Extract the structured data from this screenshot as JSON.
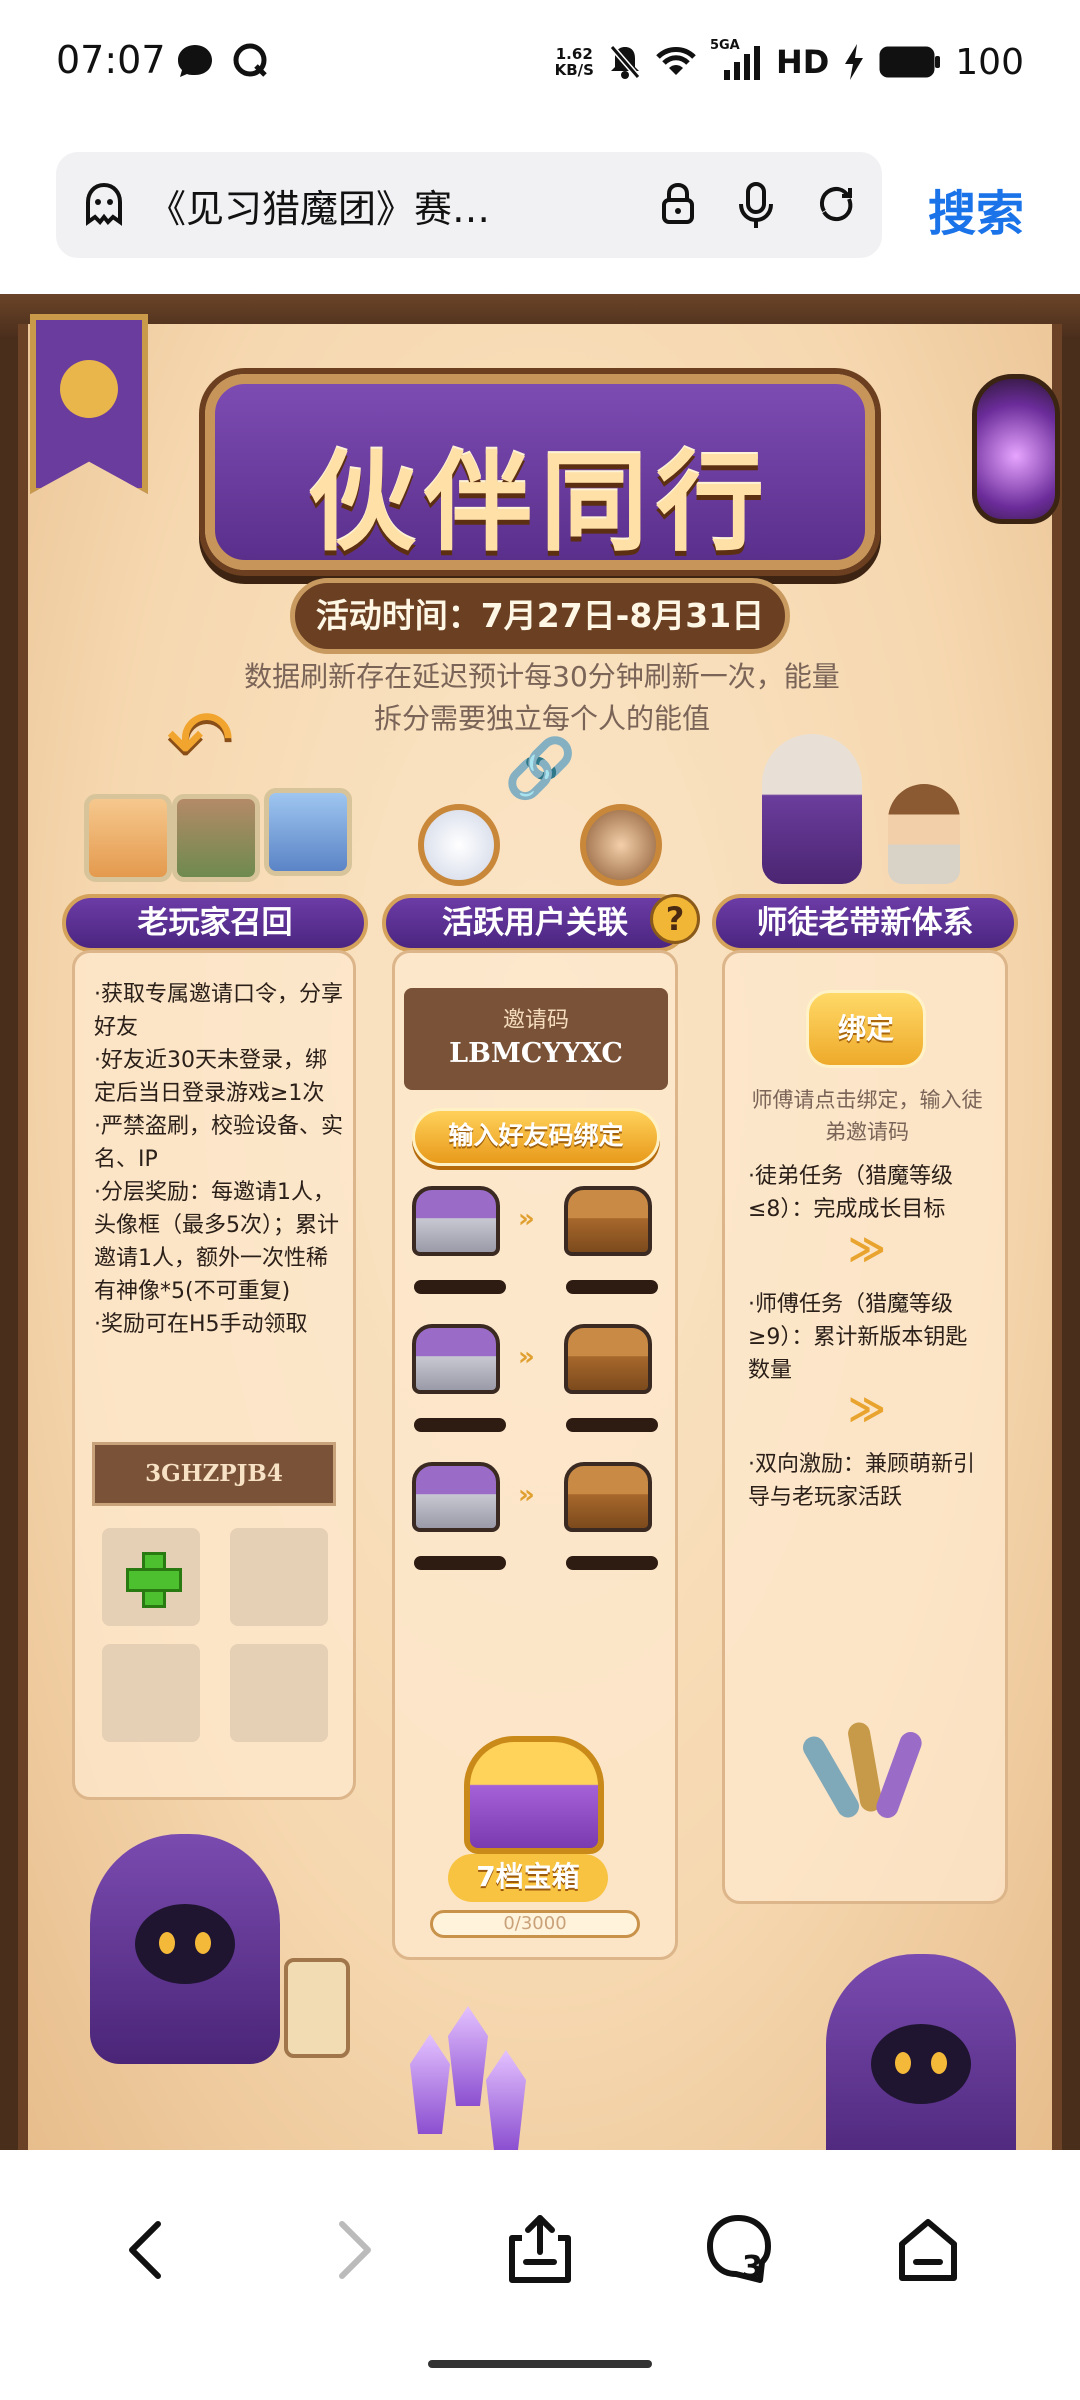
{
  "status_bar": {
    "time": "07:07",
    "net_speed_value": "1.62",
    "net_speed_unit": "KB/S",
    "network_label": "5GA",
    "hd_label": "HD",
    "battery": "100",
    "icons": [
      "chat-bubble-icon",
      "q-logo-icon",
      "mute-icon",
      "wifi-icon",
      "signal-icon",
      "charging-icon",
      "battery-icon"
    ]
  },
  "address_bar": {
    "title": "《见习猎魔团》赛…",
    "search_label": "搜索",
    "icons": [
      "ghost-icon",
      "lock-icon",
      "mic-icon",
      "refresh-icon"
    ]
  },
  "game": {
    "title": "伙伴同行",
    "event_time": "活动时间：7月27日-8月31日",
    "notice": "数据刷新存在延迟预计每30分钟刷新一次，能量拆分需要独立每个人的能值",
    "sections": {
      "left_title": "老玩家召回",
      "middle_title": "活跃用户关联",
      "middle_help": "?",
      "right_title": "师徒老带新体系"
    },
    "left": {
      "rules": [
        "·获取专属邀请口令，分享好友",
        "·好友近30天未登录，绑定后当日登录游戏≥1次",
        "·严禁盗刷，校验设备、实名、IP",
        "·分层奖励：每邀请1人，头像框（最多5次）；累计邀请1人，额外一次性稀有神像*5(不可重复)",
        "·奖励可在H5手动领取"
      ],
      "code": "3GHZPJB4"
    },
    "middle": {
      "invite_label": "邀请码",
      "invite_code": "LBMCYYXC",
      "bind_friend_button": "输入好友码绑定",
      "chest_arrow": "»",
      "big_chest_label": "7档宝箱",
      "progress_text": "0/3000",
      "progress_value": 0
    },
    "right": {
      "bind_button": "绑定",
      "hint": "师傅请点击绑定，输入徒弟邀请码",
      "rules": [
        "·徒弟任务（猎魔等级≤8）：完成成长目标",
        "·师傅任务（猎魔等级≥9）：累计新版本钥匙数量",
        "·双向激励：兼顾萌新引导与老玩家活跃"
      ],
      "chevron": "≫"
    },
    "colors": {
      "parchment": "#f6d8b0",
      "banner_purple": "#5a2f8c",
      "gold": "#f2b637",
      "wood": "#6b4225"
    }
  },
  "bottom_nav": {
    "tab_count": "3",
    "icons": [
      "back-icon",
      "forward-icon",
      "share-icon",
      "tabs-icon",
      "home-icon"
    ]
  }
}
